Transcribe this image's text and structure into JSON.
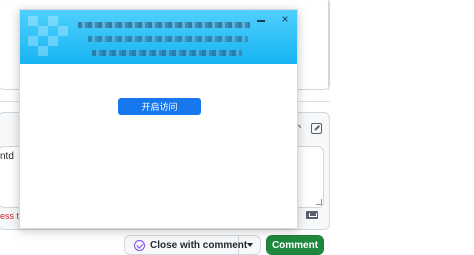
{
  "background_page": {
    "textarea_fragment": "ntd",
    "error_fragment": "ess tha",
    "buttons": {
      "close_label": "Close with comment",
      "comment_label": "Comment"
    },
    "colors": {
      "comment_green": "#1f883d",
      "close_purple": "#8250df",
      "error_red": "#cf222e"
    }
  },
  "modal": {
    "close_symbol": "×",
    "primary_button_label": "开启访问",
    "colors": {
      "header_gradient_top": "#4fd0fb",
      "header_gradient_bottom": "#17b4f4",
      "primary_blue": "#1677ee"
    },
    "icons": {
      "minimize": "minimize-icon",
      "close": "close-icon"
    }
  }
}
